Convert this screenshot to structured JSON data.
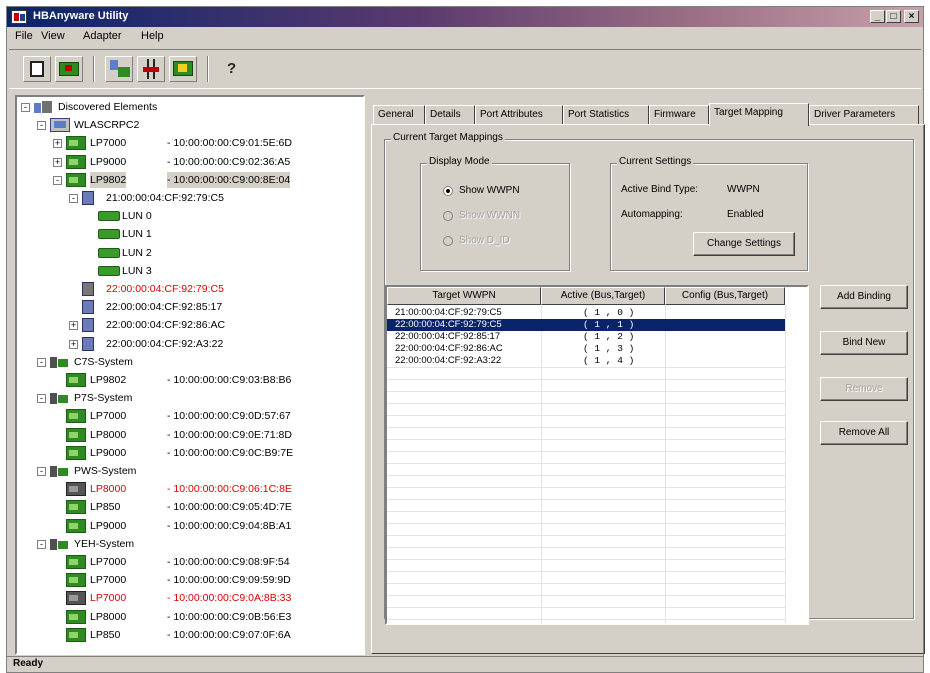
{
  "window": {
    "title": "HBAnyware Utility"
  },
  "menu": [
    "File",
    "View",
    "Adapter",
    "Help"
  ],
  "toolbar": {
    "icons": [
      "refresh-icon",
      "adapter-icon",
      "sort-by-host-icon",
      "sort-by-fabric-icon",
      "local-hba-icon",
      "help-icon"
    ]
  },
  "tree": [
    {
      "indent": 0,
      "expander": "-",
      "icon": "root",
      "label": "Discovered Elements",
      "wwn": "",
      "red": false
    },
    {
      "indent": 1,
      "expander": "-",
      "icon": "host",
      "label": "WLASCRPC2",
      "wwn": "",
      "red": false
    },
    {
      "indent": 2,
      "expander": "+",
      "icon": "adapter",
      "label": "LP7000",
      "wwn": "- 10:00:00:00:C9:01:5E:6D",
      "red": false
    },
    {
      "indent": 2,
      "expander": "+",
      "icon": "adapter",
      "label": "LP9000",
      "wwn": "- 10:00:00:00:C9:02:36:A5",
      "red": false
    },
    {
      "indent": 2,
      "expander": "-",
      "icon": "adapter",
      "label": "LP9802",
      "wwn": "- 10:00:00:00:C9:00:8E:04",
      "red": false,
      "selected": true
    },
    {
      "indent": 3,
      "expander": "-",
      "icon": "target",
      "label": "21:00:00:04:CF:92:79:C5",
      "wwn": "",
      "red": false
    },
    {
      "indent": 4,
      "expander": "",
      "icon": "lun",
      "label": "LUN  0",
      "wwn": "",
      "red": false
    },
    {
      "indent": 4,
      "expander": "",
      "icon": "lun",
      "label": "LUN  1",
      "wwn": "",
      "red": false
    },
    {
      "indent": 4,
      "expander": "",
      "icon": "lun",
      "label": "LUN  2",
      "wwn": "",
      "red": false
    },
    {
      "indent": 4,
      "expander": "",
      "icon": "lun",
      "label": "LUN  3",
      "wwn": "",
      "red": false
    },
    {
      "indent": 3,
      "expander": "",
      "icon": "target-bad",
      "label": "22:00:00:04:CF:92:79:C5",
      "wwn": "",
      "red": true
    },
    {
      "indent": 3,
      "expander": "",
      "icon": "target",
      "label": "22:00:00:04:CF:92:85:17",
      "wwn": "",
      "red": false
    },
    {
      "indent": 3,
      "expander": "+",
      "icon": "target",
      "label": "22:00:00:04:CF:92:86:AC",
      "wwn": "",
      "red": false
    },
    {
      "indent": 3,
      "expander": "+",
      "icon": "target",
      "label": "22:00:00:04:CF:92:A3:22",
      "wwn": "",
      "red": false
    },
    {
      "indent": 1,
      "expander": "-",
      "icon": "sys",
      "label": "C7S-System",
      "wwn": "",
      "red": false
    },
    {
      "indent": 2,
      "expander": "",
      "icon": "adapter",
      "label": "LP9802",
      "wwn": "- 10:00:00:00:C9:03:B8:B6",
      "red": false
    },
    {
      "indent": 1,
      "expander": "-",
      "icon": "sys",
      "label": "P7S-System",
      "wwn": "",
      "red": false
    },
    {
      "indent": 2,
      "expander": "",
      "icon": "adapter",
      "label": "LP7000",
      "wwn": "- 10:00:00:00:C9:0D:57:67",
      "red": false
    },
    {
      "indent": 2,
      "expander": "",
      "icon": "adapter",
      "label": "LP8000",
      "wwn": "- 10:00:00:00:C9:0E:71:8D",
      "red": false
    },
    {
      "indent": 2,
      "expander": "",
      "icon": "adapter",
      "label": "LP9000",
      "wwn": "- 10:00:00:00:C9:0C:B9:7E",
      "red": false
    },
    {
      "indent": 1,
      "expander": "-",
      "icon": "sys",
      "label": "PWS-System",
      "wwn": "",
      "red": false
    },
    {
      "indent": 2,
      "expander": "",
      "icon": "adapter-bad",
      "label": "LP8000",
      "wwn": "- 10:00:00:00:C9:06:1C:8E",
      "red": true
    },
    {
      "indent": 2,
      "expander": "",
      "icon": "adapter",
      "label": "LP850",
      "wwn": "- 10:00:00:00:C9:05:4D:7E",
      "red": false
    },
    {
      "indent": 2,
      "expander": "",
      "icon": "adapter",
      "label": "LP9000",
      "wwn": "- 10:00:00:00:C9:04:8B:A1",
      "red": false
    },
    {
      "indent": 1,
      "expander": "-",
      "icon": "sys",
      "label": "YEH-System",
      "wwn": "",
      "red": false
    },
    {
      "indent": 2,
      "expander": "",
      "icon": "adapter",
      "label": "LP7000",
      "wwn": "- 10:00:00:00:C9:08:9F:54",
      "red": false
    },
    {
      "indent": 2,
      "expander": "",
      "icon": "adapter",
      "label": "LP7000",
      "wwn": "- 10:00:00:00:C9:09:59:9D",
      "red": false
    },
    {
      "indent": 2,
      "expander": "",
      "icon": "adapter-bad",
      "label": "LP7000",
      "wwn": "- 10:00:00:00:C9:0A:8B:33",
      "red": true
    },
    {
      "indent": 2,
      "expander": "",
      "icon": "adapter",
      "label": "LP8000",
      "wwn": "- 10:00:00:00:C9:0B:56:E3",
      "red": false
    },
    {
      "indent": 2,
      "expander": "",
      "icon": "adapter",
      "label": "LP850",
      "wwn": "- 10:00:00:00:C9:07:0F:6A",
      "red": false
    }
  ],
  "tabs": [
    "General",
    "Details",
    "Port Attributes",
    "Port Statistics",
    "Firmware",
    "Target Mapping",
    "Driver Parameters"
  ],
  "active_tab": "Target Mapping",
  "mapping": {
    "group_label": "Current Target Mappings",
    "display_mode": {
      "label": "Display Mode",
      "options": [
        {
          "label": "Show WWPN",
          "checked": true,
          "enabled": true
        },
        {
          "label": "Show WWNN",
          "checked": false,
          "enabled": false
        },
        {
          "label": "Show D_ID",
          "checked": false,
          "enabled": false
        }
      ]
    },
    "settings": {
      "label": "Current Settings",
      "bind_type_label": "Active Bind Type:",
      "bind_type_value": "WWPN",
      "automap_label": "Automapping:",
      "automap_value": "Enabled",
      "change_button": "Change Settings"
    },
    "columns": [
      "Target WWPN",
      "Active (Bus,Target)",
      "Config (Bus,Target)"
    ],
    "rows": [
      {
        "wwpn": "21:00:00:04:CF:92:79:C5",
        "active": "( 1 , 0 )",
        "config": "",
        "selected": false
      },
      {
        "wwpn": "22:00:00:04:CF:92:79:C5",
        "active": "( 1 , 1 )",
        "config": "",
        "selected": true
      },
      {
        "wwpn": "22:00:00:04:CF:92:85:17",
        "active": "( 1 , 2 )",
        "config": "",
        "selected": false
      },
      {
        "wwpn": "22:00:00:04:CF:92:86:AC",
        "active": "( 1 , 3 )",
        "config": "",
        "selected": false
      },
      {
        "wwpn": "22:00:00:04:CF:92:A3:22",
        "active": "( 1 , 4 )",
        "config": "",
        "selected": false
      }
    ],
    "buttons": [
      {
        "label": "Add Binding",
        "enabled": true
      },
      {
        "label": "Bind New",
        "enabled": true
      },
      {
        "label": "Remove",
        "enabled": false
      },
      {
        "label": "Remove All",
        "enabled": true
      }
    ]
  },
  "status": "Ready"
}
